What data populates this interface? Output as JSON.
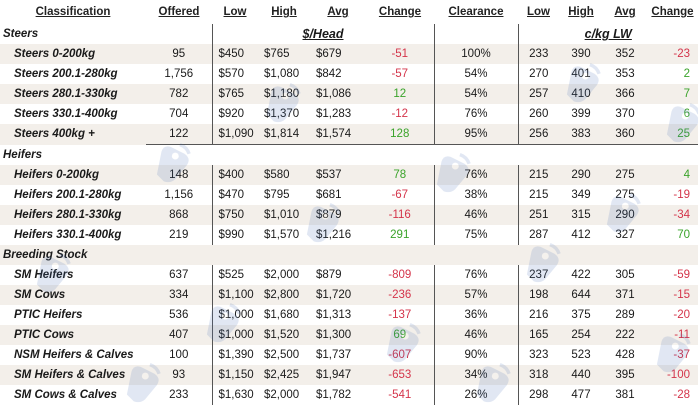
{
  "colors": {
    "positive": "#3aa32a",
    "negative": "#d4344a",
    "altRow": "#f3efea"
  },
  "watermark_icon": "ear-tag-icon",
  "headers": {
    "classification": "Classification",
    "offered": "Offered",
    "low": "Low",
    "high": "High",
    "avg": "Avg",
    "change": "Change",
    "clearance": "Clearance",
    "low2": "Low",
    "high2": "High",
    "avg2": "Avg",
    "change2": "Change"
  },
  "units": {
    "head": "$/Head",
    "lw": "c/kg LW"
  },
  "sections": [
    {
      "title": "Steers",
      "rows": [
        {
          "name": "Steers 0-200kg",
          "offered": "95",
          "low": "$450",
          "high": "$765",
          "avg": "$679",
          "change": "-51",
          "change_sign": "neg",
          "clearance": "100%",
          "low2": "233",
          "high2": "390",
          "avg2": "352",
          "change2": "-23",
          "change2_sign": "neg"
        },
        {
          "name": "Steers 200.1-280kg",
          "offered": "1,756",
          "low": "$570",
          "high": "$1,080",
          "avg": "$842",
          "change": "-57",
          "change_sign": "neg",
          "clearance": "54%",
          "low2": "270",
          "high2": "401",
          "avg2": "353",
          "change2": "2",
          "change2_sign": "pos"
        },
        {
          "name": "Steers 280.1-330kg",
          "offered": "782",
          "low": "$765",
          "high": "$1,180",
          "avg": "$1,086",
          "change": "12",
          "change_sign": "pos",
          "clearance": "54%",
          "low2": "257",
          "high2": "410",
          "avg2": "366",
          "change2": "7",
          "change2_sign": "pos"
        },
        {
          "name": "Steers 330.1-400kg",
          "offered": "704",
          "low": "$920",
          "high": "$1,370",
          "avg": "$1,283",
          "change": "-12",
          "change_sign": "neg",
          "clearance": "76%",
          "low2": "260",
          "high2": "399",
          "avg2": "370",
          "change2": "6",
          "change2_sign": "pos"
        },
        {
          "name": "Steers 400kg +",
          "offered": "122",
          "low": "$1,090",
          "high": "$1,814",
          "avg": "$1,574",
          "change": "128",
          "change_sign": "pos",
          "clearance": "95%",
          "low2": "256",
          "high2": "383",
          "avg2": "360",
          "change2": "25",
          "change2_sign": "pos"
        }
      ]
    },
    {
      "title": "Heifers",
      "rows": [
        {
          "name": "Heifers 0-200kg",
          "offered": "148",
          "low": "$400",
          "high": "$580",
          "avg": "$537",
          "change": "78",
          "change_sign": "pos",
          "clearance": "76%",
          "low2": "215",
          "high2": "290",
          "avg2": "275",
          "change2": "4",
          "change2_sign": "pos"
        },
        {
          "name": "Heifers 200.1-280kg",
          "offered": "1,156",
          "low": "$470",
          "high": "$795",
          "avg": "$681",
          "change": "-67",
          "change_sign": "neg",
          "clearance": "38%",
          "low2": "215",
          "high2": "349",
          "avg2": "275",
          "change2": "-19",
          "change2_sign": "neg"
        },
        {
          "name": "Heifers 280.1-330kg",
          "offered": "868",
          "low": "$750",
          "high": "$1,010",
          "avg": "$879",
          "change": "-116",
          "change_sign": "neg",
          "clearance": "46%",
          "low2": "251",
          "high2": "315",
          "avg2": "290",
          "change2": "-34",
          "change2_sign": "neg"
        },
        {
          "name": "Heifers 330.1-400kg",
          "offered": "219",
          "low": "$990",
          "high": "$1,570",
          "avg": "$1,216",
          "change": "291",
          "change_sign": "pos",
          "clearance": "75%",
          "low2": "287",
          "high2": "412",
          "avg2": "327",
          "change2": "70",
          "change2_sign": "pos"
        }
      ]
    },
    {
      "title": "Breeding Stock",
      "rows": [
        {
          "name": "SM Heifers",
          "offered": "637",
          "low": "$525",
          "high": "$2,000",
          "avg": "$879",
          "change": "-809",
          "change_sign": "neg",
          "clearance": "76%",
          "low2": "237",
          "high2": "422",
          "avg2": "305",
          "change2": "-59",
          "change2_sign": "neg"
        },
        {
          "name": "SM Cows",
          "offered": "334",
          "low": "$1,100",
          "high": "$2,800",
          "avg": "$1,720",
          "change": "-236",
          "change_sign": "neg",
          "clearance": "57%",
          "low2": "198",
          "high2": "644",
          "avg2": "371",
          "change2": "-15",
          "change2_sign": "neg"
        },
        {
          "name": "PTIC Heifers",
          "offered": "536",
          "low": "$1,000",
          "high": "$1,680",
          "avg": "$1,313",
          "change": "-137",
          "change_sign": "neg",
          "clearance": "36%",
          "low2": "216",
          "high2": "375",
          "avg2": "289",
          "change2": "-20",
          "change2_sign": "neg"
        },
        {
          "name": "PTIC Cows",
          "offered": "407",
          "low": "$1,000",
          "high": "$1,520",
          "avg": "$1,300",
          "change": "69",
          "change_sign": "pos",
          "clearance": "46%",
          "low2": "165",
          "high2": "254",
          "avg2": "222",
          "change2": "-11",
          "change2_sign": "neg"
        },
        {
          "name": "NSM Heifers & Calves",
          "offered": "100",
          "low": "$1,390",
          "high": "$2,500",
          "avg": "$1,737",
          "change": "-607",
          "change_sign": "neg",
          "clearance": "90%",
          "low2": "323",
          "high2": "523",
          "avg2": "428",
          "change2": "-37",
          "change2_sign": "neg"
        },
        {
          "name": "SM Heifers & Calves",
          "offered": "93",
          "low": "$1,150",
          "high": "$2,425",
          "avg": "$1,947",
          "change": "-653",
          "change_sign": "neg",
          "clearance": "34%",
          "low2": "318",
          "high2": "440",
          "avg2": "395",
          "change2": "-100",
          "change2_sign": "neg"
        },
        {
          "name": "SM Cows & Calves",
          "offered": "233",
          "low": "$1,630",
          "high": "$2,000",
          "avg": "$1,782",
          "change": "-541",
          "change_sign": "neg",
          "clearance": "26%",
          "low2": "298",
          "high2": "477",
          "avg2": "381",
          "change2": "-28",
          "change2_sign": "neg"
        }
      ]
    }
  ]
}
